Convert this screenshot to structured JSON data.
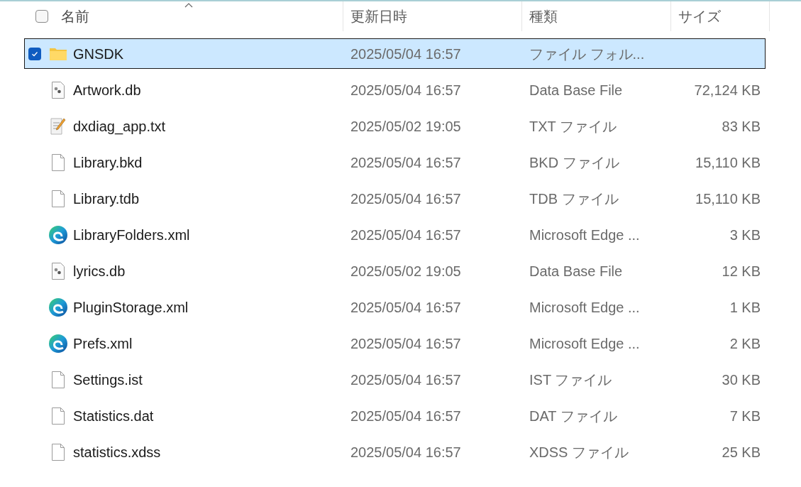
{
  "header": {
    "select_all": {
      "checked": false
    },
    "columns": [
      {
        "label": "名前",
        "sorted": true
      },
      {
        "label": "更新日時",
        "sorted": false
      },
      {
        "label": "種類",
        "sorted": false
      },
      {
        "label": "サイズ",
        "sorted": false
      }
    ]
  },
  "rows": [
    {
      "kind": "folder",
      "name": "GNSDK",
      "modified": "2025/05/04 16:57",
      "type": "ファイル フォル...",
      "size": "",
      "selected": true
    },
    {
      "kind": "db",
      "name": "Artwork.db",
      "modified": "2025/05/04 16:57",
      "type": "Data Base File",
      "size": "72,124 KB",
      "selected": false
    },
    {
      "kind": "text",
      "name": "dxdiag_app.txt",
      "modified": "2025/05/02 19:05",
      "type": "TXT ファイル",
      "size": "83 KB",
      "selected": false
    },
    {
      "kind": "blank",
      "name": "Library.bkd",
      "modified": "2025/05/04 16:57",
      "type": "BKD ファイル",
      "size": "15,110 KB",
      "selected": false
    },
    {
      "kind": "blank",
      "name": "Library.tdb",
      "modified": "2025/05/04 16:57",
      "type": "TDB ファイル",
      "size": "15,110 KB",
      "selected": false
    },
    {
      "kind": "edge",
      "name": "LibraryFolders.xml",
      "modified": "2025/05/04 16:57",
      "type": "Microsoft Edge ...",
      "size": "3 KB",
      "selected": false
    },
    {
      "kind": "db",
      "name": "lyrics.db",
      "modified": "2025/05/02 19:05",
      "type": "Data Base File",
      "size": "12 KB",
      "selected": false
    },
    {
      "kind": "edge",
      "name": "PluginStorage.xml",
      "modified": "2025/05/04 16:57",
      "type": "Microsoft Edge ...",
      "size": "1 KB",
      "selected": false
    },
    {
      "kind": "edge",
      "name": "Prefs.xml",
      "modified": "2025/05/04 16:57",
      "type": "Microsoft Edge ...",
      "size": "2 KB",
      "selected": false
    },
    {
      "kind": "blank",
      "name": "Settings.ist",
      "modified": "2025/05/04 16:57",
      "type": "IST ファイル",
      "size": "30 KB",
      "selected": false
    },
    {
      "kind": "blank",
      "name": "Statistics.dat",
      "modified": "2025/05/04 16:57",
      "type": "DAT ファイル",
      "size": "7 KB",
      "selected": false
    },
    {
      "kind": "blank",
      "name": "statistics.xdss",
      "modified": "2025/05/04 16:57",
      "type": "XDSS ファイル",
      "size": "25 KB",
      "selected": false
    }
  ]
}
